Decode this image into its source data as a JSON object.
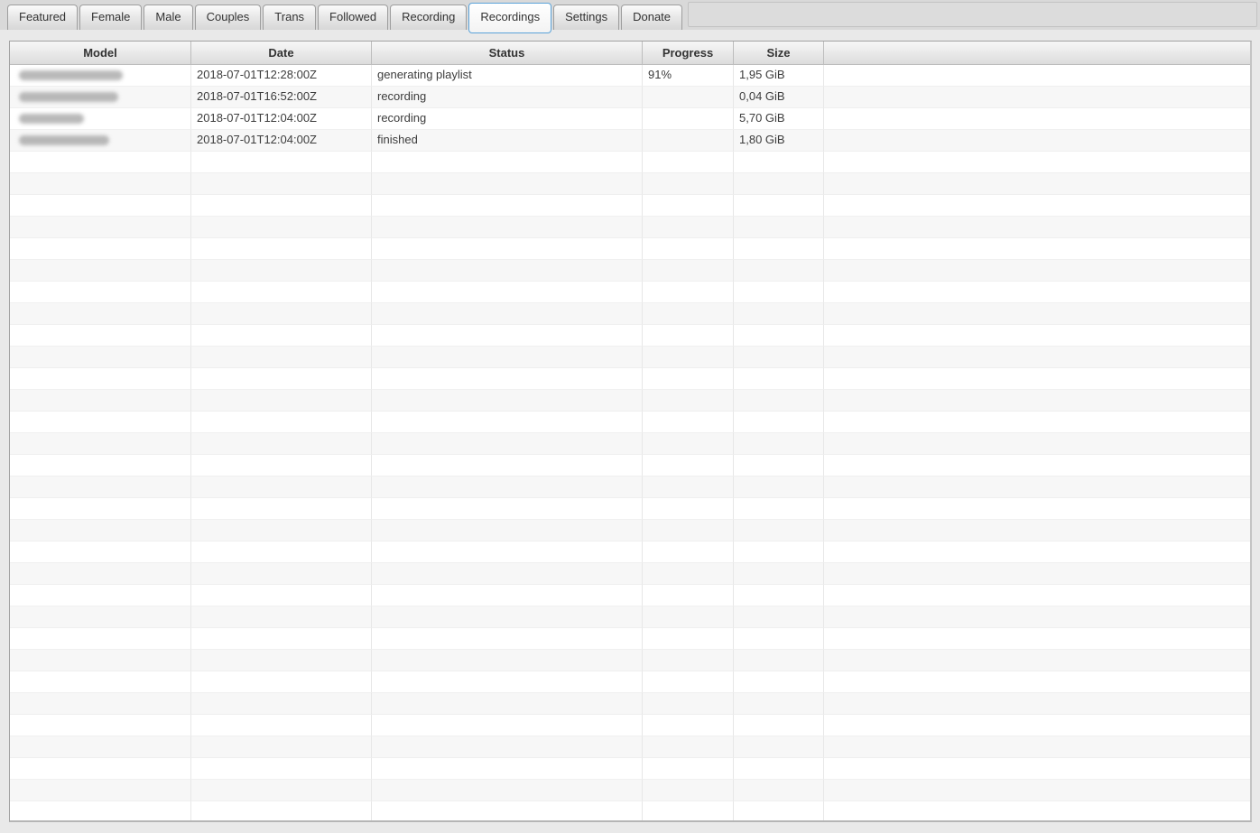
{
  "tabs": {
    "items": [
      "Featured",
      "Female",
      "Male",
      "Couples",
      "Trans",
      "Followed",
      "Recording",
      "Recordings",
      "Settings",
      "Donate"
    ],
    "active": "Recordings"
  },
  "colors": {
    "active_tab_border": "#5ba3d9",
    "header_gradient_top": "#f7f7f7",
    "header_gradient_bottom": "#dcdcdc",
    "row_stripe": "#f7f7f7"
  },
  "table": {
    "columns": [
      "Model",
      "Date",
      "Status",
      "Progress",
      "Size"
    ],
    "rows": [
      {
        "model": "",
        "model_redacted": true,
        "redacted_width": 115,
        "date": "2018-07-01T12:28:00Z",
        "status": "generating playlist",
        "progress": "91%",
        "size": "1,95 GiB"
      },
      {
        "model": "",
        "model_redacted": true,
        "redacted_width": 110,
        "date": "2018-07-01T16:52:00Z",
        "status": "recording",
        "progress": "",
        "size": "0,04 GiB"
      },
      {
        "model": "",
        "model_redacted": true,
        "redacted_width": 72,
        "date": "2018-07-01T12:04:00Z",
        "status": "recording",
        "progress": "",
        "size": "5,70 GiB"
      },
      {
        "model": "",
        "model_redacted": true,
        "redacted_width": 100,
        "date": "2018-07-01T12:04:00Z",
        "status": "finished",
        "progress": "",
        "size": "1,80 GiB"
      }
    ],
    "empty_row_count": 31
  }
}
